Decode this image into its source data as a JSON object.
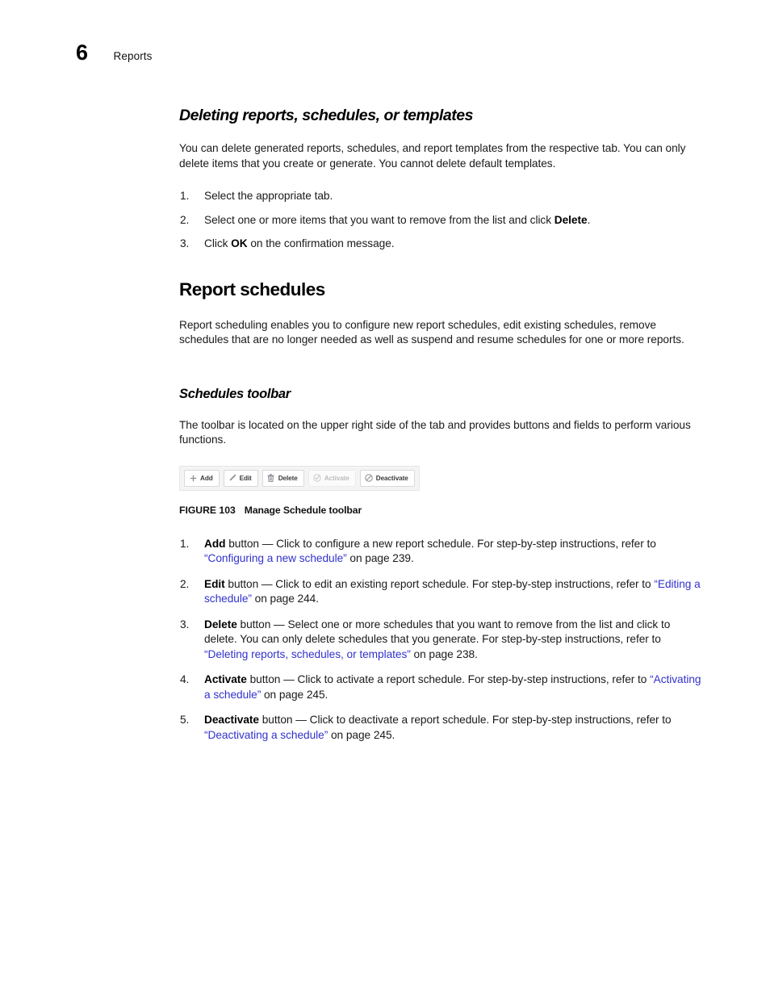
{
  "header": {
    "chapter_number": "6",
    "chapter_title": "Reports"
  },
  "sections": {
    "deleting": {
      "heading": "Deleting reports, schedules, or templates",
      "intro": "You can delete generated reports, schedules, and report templates from the respective tab. You can only delete items that you create or generate. You cannot delete default templates.",
      "steps": [
        {
          "num": "1.",
          "pre": "Select the appropriate tab.",
          "bold": "",
          "post": ""
        },
        {
          "num": "2.",
          "pre": "Select one or more items that you want to remove from the list and click ",
          "bold": "Delete",
          "post": "."
        },
        {
          "num": "3.",
          "pre": "Click ",
          "bold": "OK",
          "post": " on the confirmation message."
        }
      ]
    },
    "report_schedules": {
      "heading": "Report schedules",
      "intro": "Report scheduling enables you to configure new report schedules, edit existing schedules, remove schedules that are no longer needed as well as suspend and resume schedules for one or more reports."
    },
    "schedules_toolbar": {
      "heading": "Schedules toolbar",
      "intro": "The toolbar is located on the upper right side of the tab and provides buttons and fields to perform various functions.",
      "toolbar_buttons": [
        {
          "label": "Add",
          "icon": "plus-icon",
          "disabled": false
        },
        {
          "label": "Edit",
          "icon": "pencil-icon",
          "disabled": false
        },
        {
          "label": "Delete",
          "icon": "trash-icon",
          "disabled": false
        },
        {
          "label": "Activate",
          "icon": "check-circle-icon",
          "disabled": true
        },
        {
          "label": "Deactivate",
          "icon": "prohibition-icon",
          "disabled": false
        }
      ],
      "figure": {
        "label": "FIGURE 103",
        "title": "Manage Schedule toolbar"
      },
      "button_descriptions": [
        {
          "num": "1.",
          "bold": "Add",
          "text_before_link": " button — Click to configure a new report schedule. For step-by-step instructions, refer to ",
          "link": "“Configuring a new schedule”",
          "text_after_link": " on page 239."
        },
        {
          "num": "2.",
          "bold": "Edit",
          "text_before_link": " button — Click to edit an existing report schedule. For step-by-step instructions, refer to ",
          "link": "“Editing a schedule”",
          "text_after_link": " on page 244."
        },
        {
          "num": "3.",
          "bold": "Delete",
          "text_before_link": " button — Select one or more schedules that you want to remove from the list and click to delete. You can only delete schedules that you generate. For step-by-step instructions, refer to ",
          "link": "“Deleting reports, schedules, or templates”",
          "text_after_link": " on page 238."
        },
        {
          "num": "4.",
          "bold": "Activate",
          "text_before_link": " button — Click to activate a report schedule. For step-by-step instructions, refer to ",
          "link": "“Activating a schedule”",
          "text_after_link": " on page 245."
        },
        {
          "num": "5.",
          "bold": "Deactivate",
          "text_before_link": " button — Click to deactivate a report schedule. For step-by-step instructions, refer to ",
          "link": "“Deactivating a schedule”",
          "text_after_link": " on page 245."
        }
      ]
    }
  },
  "colors": {
    "link": "#3232cd",
    "text": "#1a1a1a",
    "toolbar_button_text": "#3b3b3b",
    "toolbar_disabled_text": "#bdbdbd",
    "toolbar_background": "#f4f4f4"
  }
}
